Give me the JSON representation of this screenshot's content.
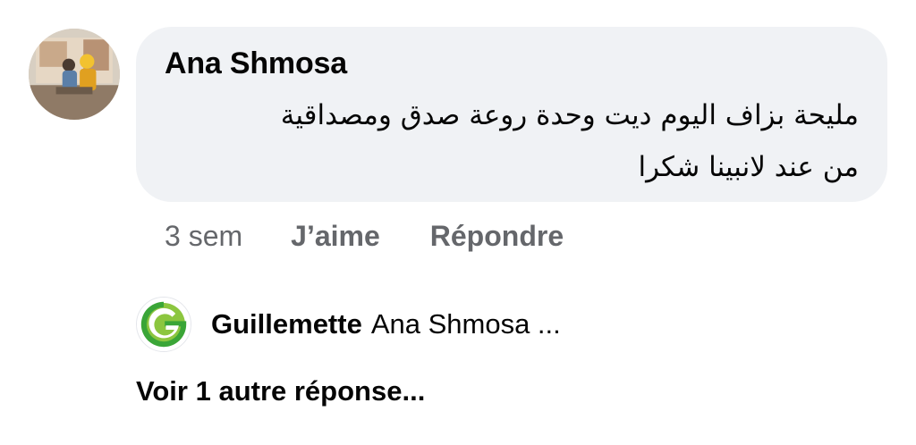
{
  "comment": {
    "avatar_icon": "user-avatar-photo",
    "author": "Ana Shmosa",
    "text_line1": "مليحة بزاف اليوم ديت وحدة روعة صدق ومصداقية",
    "text_line2": "من عند لانبينا شكرا",
    "bubble_color": "#f0f2f5"
  },
  "actions": {
    "time": "3 sem",
    "like_label": "J’aime",
    "reply_label": "Répondre",
    "color": "#65676b"
  },
  "reply_preview": {
    "avatar_icon": "guillemette-logo-icon",
    "author": "Guillemette",
    "snippet": "Ana Shmosa ...",
    "logo_colors": [
      "#8cc63f",
      "#3aa537"
    ]
  },
  "more_replies_label": "Voir 1 autre réponse..."
}
